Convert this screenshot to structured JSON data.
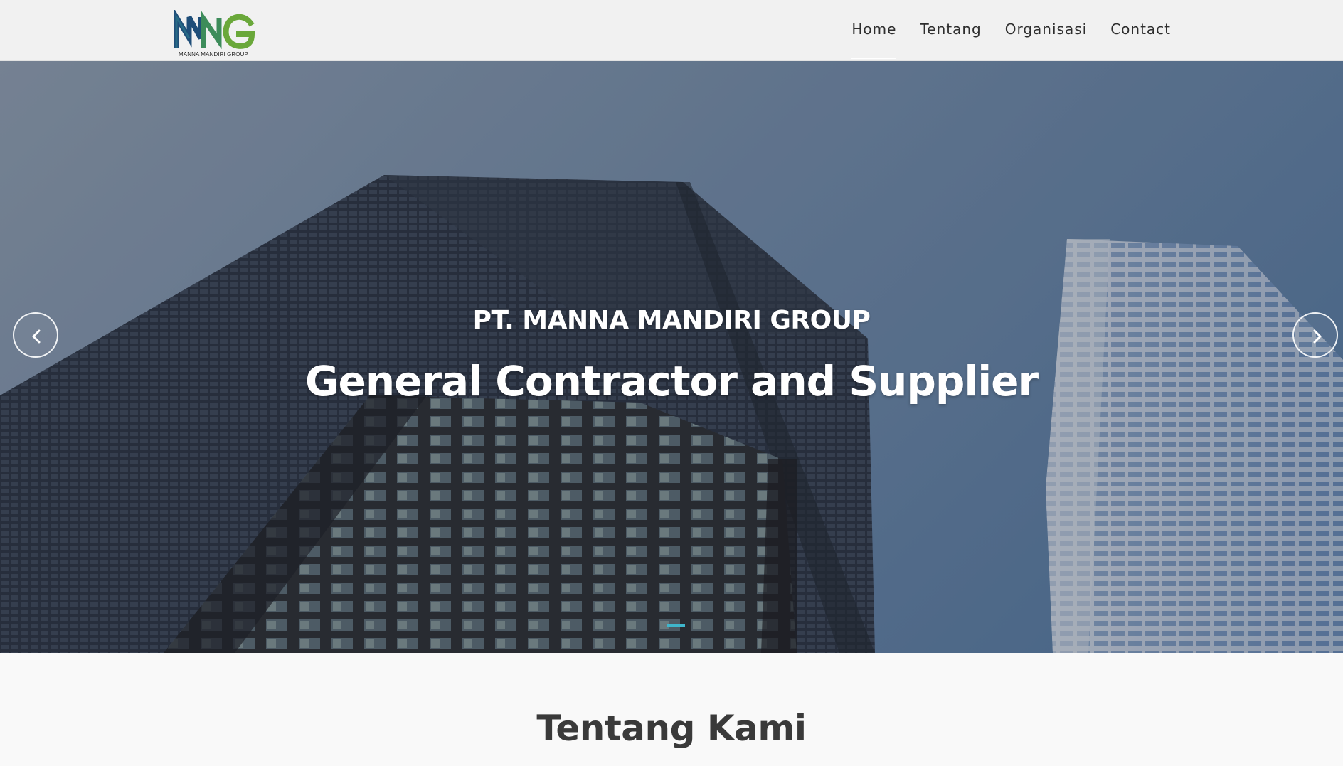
{
  "header": {
    "logo": {
      "letters": "MNG",
      "caption": "MANNA MANDIRI GROUP"
    },
    "nav": [
      {
        "label": "Home",
        "active": true
      },
      {
        "label": "Tentang",
        "active": false
      },
      {
        "label": "Organisasi",
        "active": false
      },
      {
        "label": "Contact",
        "active": false
      }
    ]
  },
  "hero": {
    "subtitle": "PT. MANNA MANDIRI GROUP",
    "title": "General Contractor and Supplier",
    "prev_icon": "chevron-left-icon",
    "next_icon": "chevron-right-icon",
    "slide_count": 1,
    "active_slide": 1
  },
  "about": {
    "title": "Tentang Kami"
  },
  "colors": {
    "accent": "#3fb6cc",
    "logo_blue": "#1f4e79",
    "logo_green": "#6aa83a",
    "heading": "#3a3a3a"
  }
}
